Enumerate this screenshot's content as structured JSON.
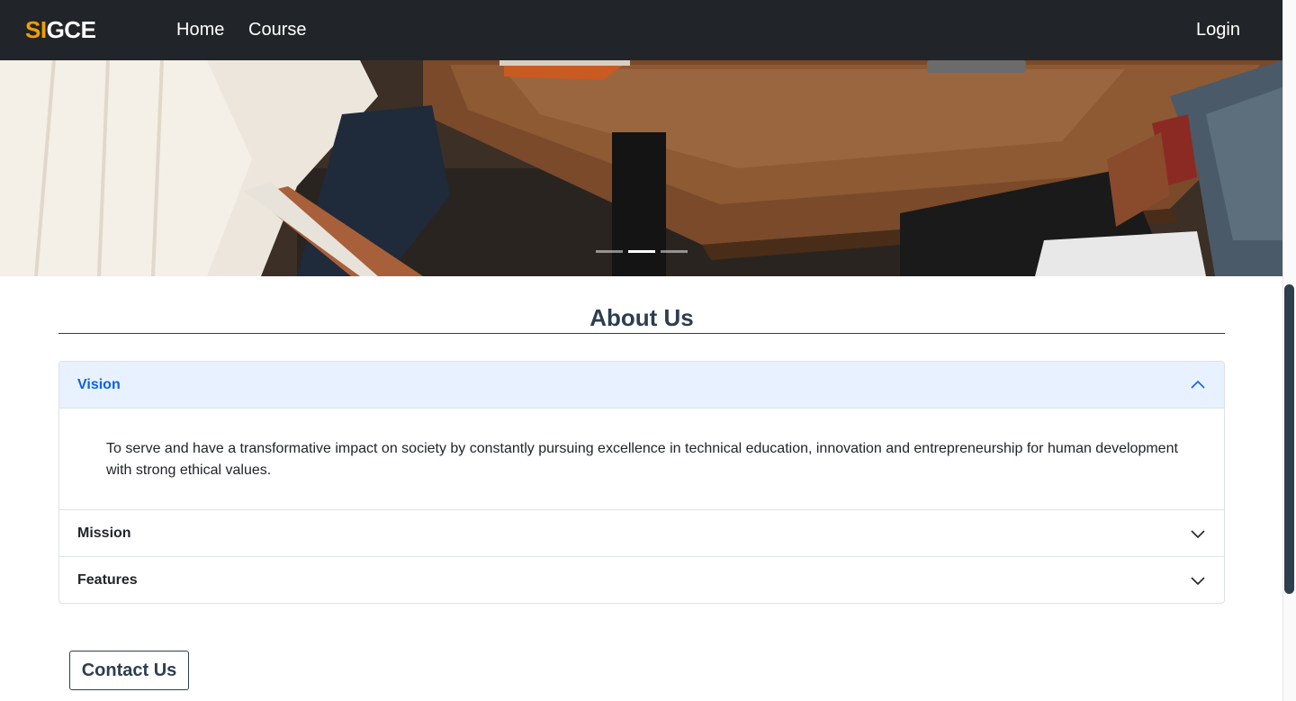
{
  "navbar": {
    "brand_accent": "SI",
    "brand_rest": "GCE",
    "links": [
      "Home",
      "Course"
    ],
    "login_label": "Login"
  },
  "carousel": {
    "slide_count": 3,
    "active_index": 1
  },
  "about": {
    "title": "About Us",
    "sections": [
      {
        "label": "Vision",
        "expanded": true,
        "body": "To serve and have a transformative impact on society by constantly pursuing excellence in technical education, innovation and entrepreneurship for human development with strong ethical values."
      },
      {
        "label": "Mission",
        "expanded": false
      },
      {
        "label": "Features",
        "expanded": false
      }
    ]
  },
  "contact": {
    "label": "Contact Us"
  },
  "colors": {
    "navbar_bg": "#212529",
    "brand_accent": "#f0a000",
    "heading": "#2c3e50",
    "accordion_active_bg": "#e7f1ff",
    "accordion_active_text": "#0c63e4"
  },
  "icons": {
    "expanded": "chevron-up-icon",
    "collapsed": "chevron-down-icon"
  }
}
